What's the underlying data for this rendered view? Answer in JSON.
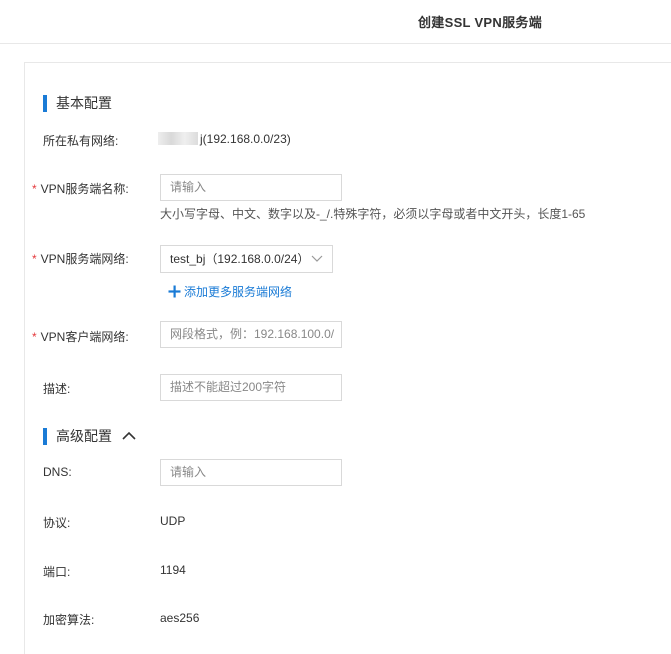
{
  "header": {
    "title": "创建SSL VPN服务端"
  },
  "basic": {
    "section_title": "基本配置",
    "vpc_label": "所在私有网络:",
    "vpc_value": "j(192.168.0.0/23)",
    "name_label": "VPN服务端名称:",
    "name_placeholder": "请输入",
    "name_hint": "大小写字母、中文、数字以及-_/.特殊字符，必须以字母或者中文开头，长度1-65",
    "server_net_label": "VPN服务端网络:",
    "server_net_value": "test_bj（192.168.0.0/24）",
    "add_more_label": "添加更多服务端网络",
    "client_net_label": "VPN客户端网络:",
    "client_net_placeholder": "网段格式，例：192.168.100.0/",
    "desc_label": "描述:",
    "desc_placeholder": "描述不能超过200字符",
    "required_mark": "*"
  },
  "advanced": {
    "section_title": "高级配置",
    "dns_label": "DNS:",
    "dns_placeholder": "请输入",
    "protocol_label": "协议:",
    "protocol_value": "UDP",
    "port_label": "端口:",
    "port_value": "1194",
    "cipher_label": "加密算法:",
    "cipher_value": "aes256"
  },
  "icons": [
    "chevron-up-icon",
    "chevron-down-icon",
    "plus-icon"
  ],
  "colors": {
    "accent": "#1a7bd6",
    "required": "#e4393c",
    "border": "#d9d9d9"
  }
}
